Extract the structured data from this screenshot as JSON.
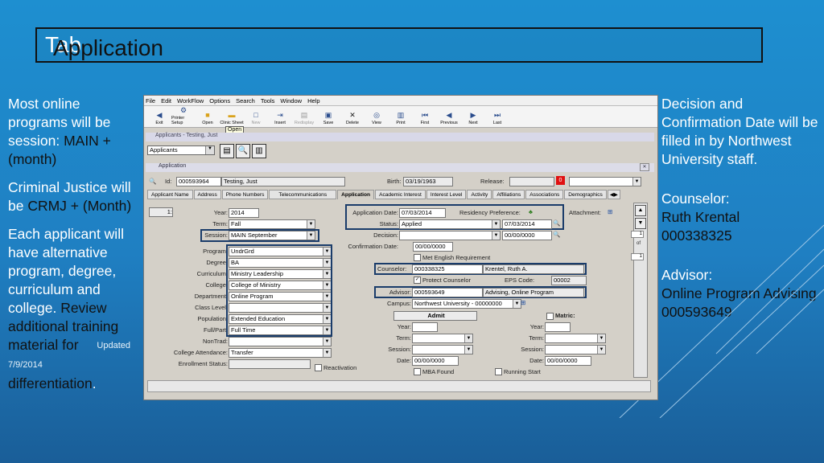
{
  "slide": {
    "title_main": "Application",
    "title_accent": "Tab",
    "left_p1": "Most online programs will be session: ",
    "left_p1_hl": "MAIN + (month)",
    "left_p2": "Criminal Justice will be ",
    "left_p2_hl": "CRMJ + (Month)",
    "left_p3_a": "Each applicant will have alternative program, degree, curriculum and college. ",
    "left_p3_b": "Review additional training material for ",
    "left_p3_c": "differentiation",
    "left_p3_end": ".",
    "updated": "Updated 7/9/2014",
    "right_p1": "Decision and Confirmation Date will be filled in by Northwest University staff.",
    "right_p2_head": "Counselor:",
    "right_p2_name": "Ruth Krental",
    "right_p2_id": "000338325",
    "right_p3_head": "Advisor:",
    "right_p3_name": "Online Program Advising",
    "right_p3_id": "000593649"
  },
  "app": {
    "menu": [
      "File",
      "Edit",
      "WorkFlow",
      "Options",
      "Search",
      "Tools",
      "Window",
      "Help"
    ],
    "toolbar": [
      "Exit",
      "Printer Setup",
      "Open",
      "Clinic Sheet",
      "New",
      "Insert",
      "Redisplay",
      "Save",
      "Delete",
      "View",
      "Print",
      "First",
      "Previous",
      "Next",
      "Last"
    ],
    "tooltip": "Open",
    "window_title": "Applicants - Testing, Just",
    "applicants_select": "Applicants",
    "app_window_title": "Application",
    "id_label": "Id:",
    "id_value": "000593964",
    "name_value": "Testing, Just",
    "birth_label": "Birth:",
    "birth_value": "03/19/1963",
    "release_label": "Release:",
    "red_badge": "0",
    "tabs": [
      "Applicant Name",
      "Address",
      "Phone Numbers",
      "Telecommunications",
      "Application",
      "Academic Interest",
      "Interest Level",
      "Activity",
      "Affiliations",
      "Associations",
      "Demographics"
    ],
    "record_num": "1:",
    "fields_left": [
      {
        "label": "Year:",
        "value": "2014"
      },
      {
        "label": "Term:",
        "value": "Fall"
      },
      {
        "label": "Session:",
        "value": "MAIN September"
      },
      {
        "label": "Program:",
        "value": "UndrGrd"
      },
      {
        "label": "Degree:",
        "value": "BA"
      },
      {
        "label": "Curriculum:",
        "value": "Ministry Leadership"
      },
      {
        "label": "College:",
        "value": "College of Ministry"
      },
      {
        "label": "Department:",
        "value": "Online Program"
      },
      {
        "label": "Class Level:",
        "value": ""
      },
      {
        "label": "Population:",
        "value": "Extended Education"
      },
      {
        "label": "Full/Part:",
        "value": "Full Time"
      },
      {
        "label": "NonTrad:",
        "value": ""
      },
      {
        "label": "College Attendance:",
        "value": "Transfer"
      },
      {
        "label": "Enrollment Status:",
        "value": ""
      }
    ],
    "reactivation": "Reactivation",
    "app_date_label": "Application Date:",
    "app_date_value": "07/03/2014",
    "residency_label": "Residency Preference:",
    "attachment_label": "Attachment:",
    "status_label": "Status:",
    "status_value": "Applied",
    "status_date": "07/03/2014",
    "decision_label": "Decision:",
    "decision_date": "00/00/0000",
    "confirm_label": "Confirmation Date:",
    "confirm_value": "00/00/0000",
    "met_english": "Met English Requirement",
    "counselor_label": "Counselor:",
    "counselor_id": "000338325",
    "counselor_name": "Krentel, Ruth A.",
    "protect": "Protect Counselor",
    "eps_label": "EPS Code:",
    "eps_value": "00002",
    "advisor_label": "Advisor:",
    "advisor_id": "000593649",
    "advisor_name": "Advising, Online Program",
    "campus_label": "Campus:",
    "campus_value": "Northwest University - 00000000",
    "admit": "Admit",
    "matric": "Matric:",
    "year_label": "Year:",
    "term_label": "Term:",
    "session_label": "Session:",
    "date_label": "Date:",
    "admit_date": "00/00/0000",
    "matric_date": "00/00/0000",
    "mba_found": "MBA Found",
    "running_start": "Running Start",
    "side_1": "1",
    "side_of": "of",
    "side_2": "1"
  }
}
